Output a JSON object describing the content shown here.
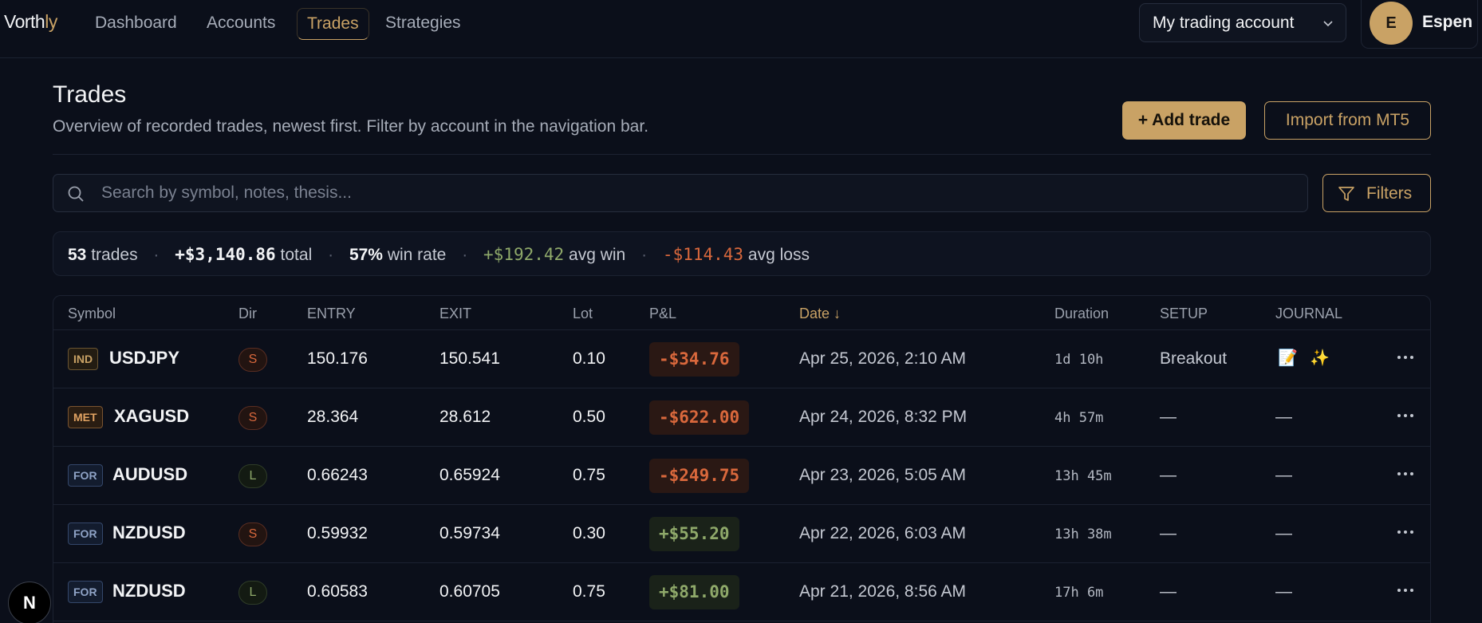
{
  "brand": {
    "name_main": "Vorth",
    "name_accent": "ly"
  },
  "nav": {
    "links": [
      "Dashboard",
      "Accounts",
      "Trades",
      "Strategies"
    ],
    "active": "Trades"
  },
  "account_selector": {
    "value": "My trading account"
  },
  "user": {
    "initial": "E",
    "name": "Espen"
  },
  "page": {
    "title": "Trades",
    "subtitle": "Overview of recorded trades, newest first. Filter by account in the navigation bar.",
    "add_button": "+ Add trade",
    "import_button": "Import from MT5"
  },
  "search": {
    "placeholder": "Search by symbol, notes, thesis..."
  },
  "filters_button": "Filters",
  "stats": {
    "trades_count": "53",
    "trades_label": "trades",
    "total_value": "+$3,140.86",
    "total_label": "total",
    "win_rate_value": "57%",
    "win_rate_label": "win rate",
    "avg_win_value": "+$192.42",
    "avg_win_label": "avg win",
    "avg_loss_value": "-$114.43",
    "avg_loss_label": "avg loss",
    "separator": "·"
  },
  "table": {
    "columns": {
      "symbol": "Symbol",
      "dir": "Dir",
      "entry": "ENTRY",
      "exit": "EXIT",
      "lot": "Lot",
      "pnl": "P&L",
      "date": "Date ↓",
      "duration": "Duration",
      "setup": "SETUP",
      "journal": "JOURNAL"
    },
    "rows": [
      {
        "tag": "IND",
        "symbol": "USDJPY",
        "dir": "S",
        "entry": "150.176",
        "exit": "150.541",
        "lot": "0.10",
        "pnl": "-$34.76",
        "date": "Apr 25, 2026, 2:10 AM",
        "duration": "1d 10h",
        "setup": "Breakout",
        "journal_icons": [
          "📝",
          "✨"
        ]
      },
      {
        "tag": "MET",
        "symbol": "XAGUSD",
        "dir": "S",
        "entry": "28.364",
        "exit": "28.612",
        "lot": "0.50",
        "pnl": "-$622.00",
        "date": "Apr 24, 2026, 8:32 PM",
        "duration": "4h 57m",
        "setup": "—",
        "journal": "—"
      },
      {
        "tag": "FOR",
        "symbol": "AUDUSD",
        "dir": "L",
        "entry": "0.66243",
        "exit": "0.65924",
        "lot": "0.75",
        "pnl": "-$249.75",
        "date": "Apr 23, 2026, 5:05 AM",
        "duration": "13h 45m",
        "setup": "—",
        "journal": "—"
      },
      {
        "tag": "FOR",
        "symbol": "NZDUSD",
        "dir": "S",
        "entry": "0.59932",
        "exit": "0.59734",
        "lot": "0.30",
        "pnl": "+$55.20",
        "date": "Apr 22, 2026, 6:03 AM",
        "duration": "13h 38m",
        "setup": "—",
        "journal": "—"
      },
      {
        "tag": "FOR",
        "symbol": "NZDUSD",
        "dir": "L",
        "entry": "0.60583",
        "exit": "0.60705",
        "lot": "0.75",
        "pnl": "+$81.00",
        "date": "Apr 21, 2026, 8:56 AM",
        "duration": "17h 6m",
        "setup": "—",
        "journal": "—"
      }
    ]
  },
  "dev_badge": "N",
  "colors": {
    "background": "#0b0f1a",
    "accent": "#c9a265",
    "positive": "#8fa96a",
    "negative": "#d9683c"
  }
}
